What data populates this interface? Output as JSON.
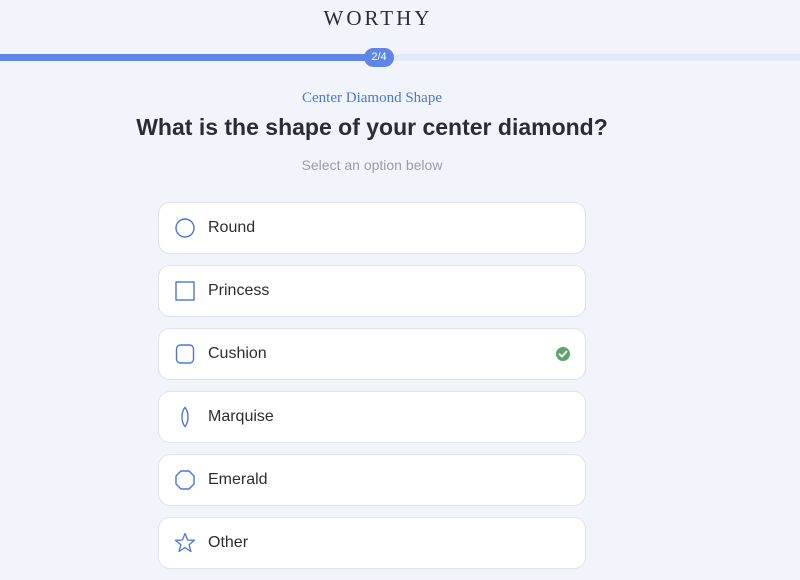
{
  "brand": {
    "logo_text": "WORTHY"
  },
  "progress": {
    "step_label": "2/4",
    "fraction": 0.47
  },
  "header": {
    "eyebrow": "Center Diamond Shape",
    "question": "What is the shape of your center diamond?",
    "hint": "Select an option below"
  },
  "options": [
    {
      "label": "Round",
      "icon": "round-shape-icon",
      "selected": false
    },
    {
      "label": "Princess",
      "icon": "princess-shape-icon",
      "selected": false
    },
    {
      "label": "Cushion",
      "icon": "cushion-shape-icon",
      "selected": true
    },
    {
      "label": "Marquise",
      "icon": "marquise-shape-icon",
      "selected": false
    },
    {
      "label": "Emerald",
      "icon": "emerald-shape-icon",
      "selected": false
    },
    {
      "label": "Other",
      "icon": "star-icon",
      "selected": false
    }
  ],
  "colors": {
    "accent": "#5d86e6",
    "icon_stroke": "#4a78d6",
    "check": "#5fa56e"
  }
}
